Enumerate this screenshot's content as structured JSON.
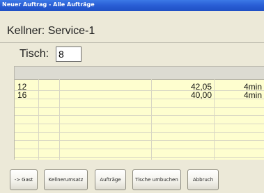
{
  "window": {
    "title": "Neuer Auftrag - Alle Aufträge"
  },
  "header": {
    "waiter_label": "Kellner: Service-1"
  },
  "table_selector": {
    "label": "Tisch:",
    "value": "8"
  },
  "orders": {
    "rows": [
      {
        "table": "12",
        "amount": "42,05",
        "time": "4min"
      },
      {
        "table": "16",
        "amount": "40,00",
        "time": "4min"
      }
    ]
  },
  "buttons": {
    "guest": {
      "label": "Gast",
      "icon": "arrow-right-icon"
    },
    "waiter_sales": "Kellnerumsatz",
    "orders": "Aufträge",
    "move_tables": "Tische umbuchen",
    "cancel": "Abbruch"
  }
}
